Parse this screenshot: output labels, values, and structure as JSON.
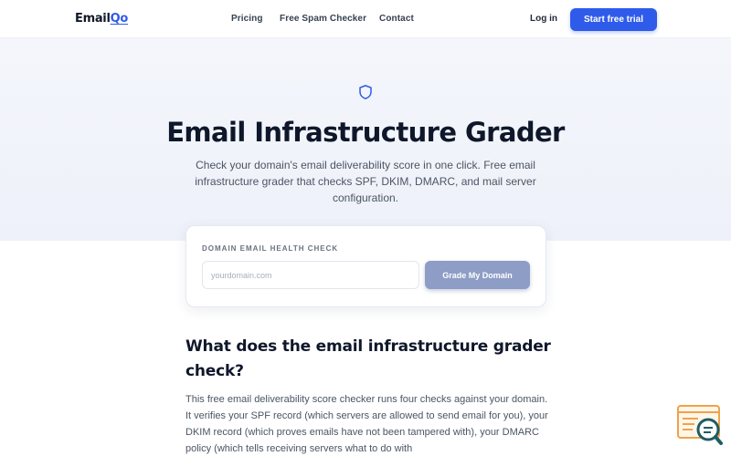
{
  "header": {
    "logo_prefix": "Email",
    "logo_accent": "Qo",
    "nav": [
      "Pricing",
      "Free Spam Checker",
      "Contact"
    ],
    "login_label": "Log in",
    "cta_label": "Start free trial"
  },
  "hero": {
    "icon": "shield-icon",
    "title": "Email Infrastructure Grader",
    "subtitle": "Check your domain's email deliverability score in one click. Free email infrastructure grader that checks SPF, DKIM, DMARC, and mail server configuration."
  },
  "card": {
    "label": "DOMAIN EMAIL HEALTH CHECK",
    "input_placeholder": "yourdomain.com",
    "input_value": "",
    "button_label": "Grade My Domain"
  },
  "section": {
    "title": "What does the email infrastructure grader check?",
    "body": "This free email deliverability score checker runs four checks against your domain. It verifies your SPF record (which servers are allowed to send email for you), your DKIM record (which proves emails have not been tampered with), your DMARC policy (which tells receiving servers what to do with"
  },
  "widget": {
    "icon": "email-search-icon"
  },
  "colors": {
    "accent": "#2f5bea",
    "grade_button": "#8e9dc6",
    "widget_orange": "#f0a24a",
    "widget_teal": "#1f5d63"
  }
}
